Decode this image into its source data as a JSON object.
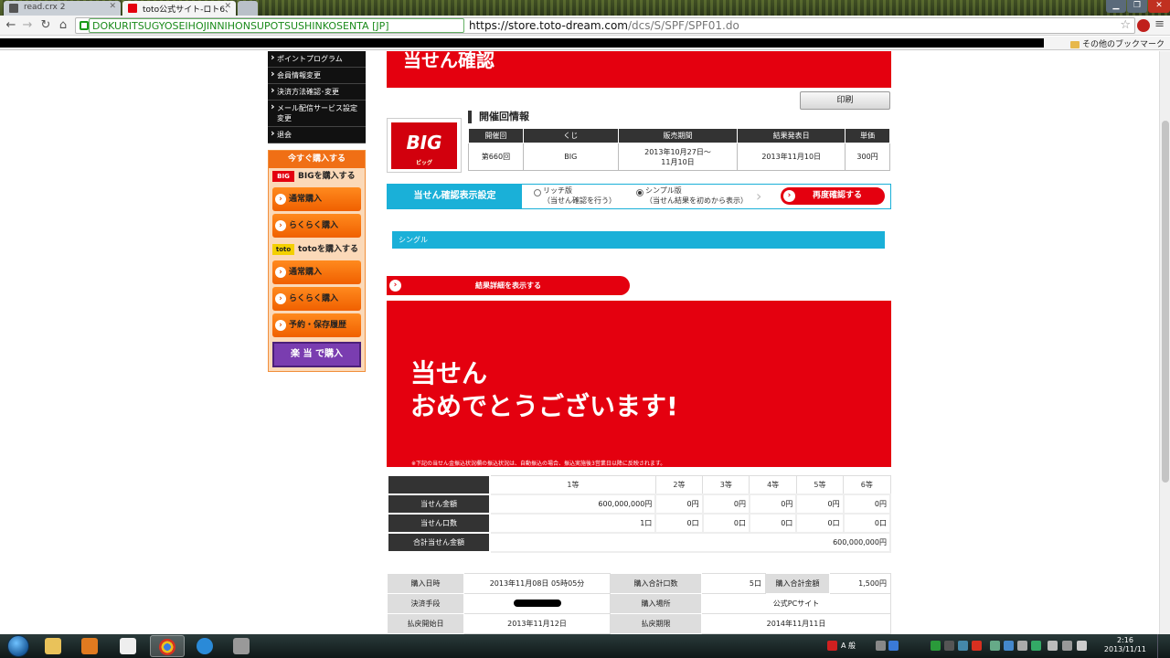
{
  "browser": {
    "tabs": [
      {
        "label": "read.crx 2",
        "active": false
      },
      {
        "label": "toto公式サイト-ロト6、",
        "active": true
      }
    ],
    "ev_label": "DOKURITSUGYOSEIHOJINNIHONSUPOTSUSHINKOSENTA [JP]",
    "url_host": "https://store.toto-dream.com",
    "url_path": "/dcs/S/SPF/SPF01.do",
    "other_bookmarks": "その他のブックマーク"
  },
  "sidebar": {
    "menu": [
      "ポイントプログラム",
      "会員情報変更",
      "決済方法確認･変更",
      "メール配信サービス設定変更",
      "退会"
    ],
    "buy_now": "今すぐ購入する",
    "big_section": {
      "logo": "BIG",
      "title": "BIGを購入する",
      "buttons": [
        "通常購入",
        "らくらく購入"
      ]
    },
    "toto_section": {
      "logo": "toto",
      "title": "totoを購入する",
      "buttons": [
        "通常購入",
        "らくらく購入",
        "予約・保存履歴"
      ]
    },
    "rakutou": "楽 当 で購入"
  },
  "main": {
    "page_title": "当せん確認",
    "print": "印刷",
    "big_logo": "BIG",
    "big_logo_sub": "ビッグ",
    "section_title": "開催回情報",
    "info_headers": [
      "開催回",
      "くじ",
      "販売期間",
      "結果発表日",
      "単価"
    ],
    "info_row": [
      "第660回",
      "BIG",
      "2013年10月27日～\n11月10日",
      "2013年11月10日",
      "300円"
    ],
    "settings_label": "当せん確認表示設定",
    "rich_label": "リッチ版",
    "rich_desc": "（当せん確認を行う）",
    "simple_label": "シンプル版",
    "simple_desc": "（当せん結果を初めから表示）",
    "recheck": "再度確認する",
    "single": "シングル",
    "detail": "結果詳細を表示する",
    "hero_line1": "当せん",
    "hero_line2": "おめでとうございます!",
    "hero_note": "※下記の当せん金振込状況欄の振込状況は、自動振込の場合、振込実施後3営業日以降に反映されます。",
    "prize_cols": [
      "1等",
      "2等",
      "3等",
      "4等",
      "5等",
      "6等"
    ],
    "prize_amount_label": "当せん金額",
    "prize_amounts": [
      "600,000,000円",
      "0円",
      "0円",
      "0円",
      "0円",
      "0円"
    ],
    "prize_count_label": "当せん口数",
    "prize_counts": [
      "1口",
      "0口",
      "0口",
      "0口",
      "0口",
      "0口"
    ],
    "total_label": "合計当せん金額",
    "total_value": "600,000,000円",
    "purchase": {
      "date_label": "購入日時",
      "date_value": "2013年11月08日 05時05分",
      "units_label": "購入合計口数",
      "units_value": "5口",
      "amount_label": "購入合計金額",
      "amount_value": "1,500円",
      "payment_label": "決済手段",
      "place_label": "購入場所",
      "place_value": "公式PCサイト",
      "refund_start_label": "払戻開始日",
      "refund_start_value": "2013年11月12日",
      "refund_end_label": "払戻期限",
      "refund_end_value": "2014年11月11日"
    }
  },
  "taskbar": {
    "clock_time": "2:16",
    "clock_date": "2013/11/11",
    "ime": "A 般"
  },
  "colors": {
    "brand_red": "#e4000f",
    "accent_cyan": "#1ab0d8",
    "orange": "#f06f15"
  }
}
